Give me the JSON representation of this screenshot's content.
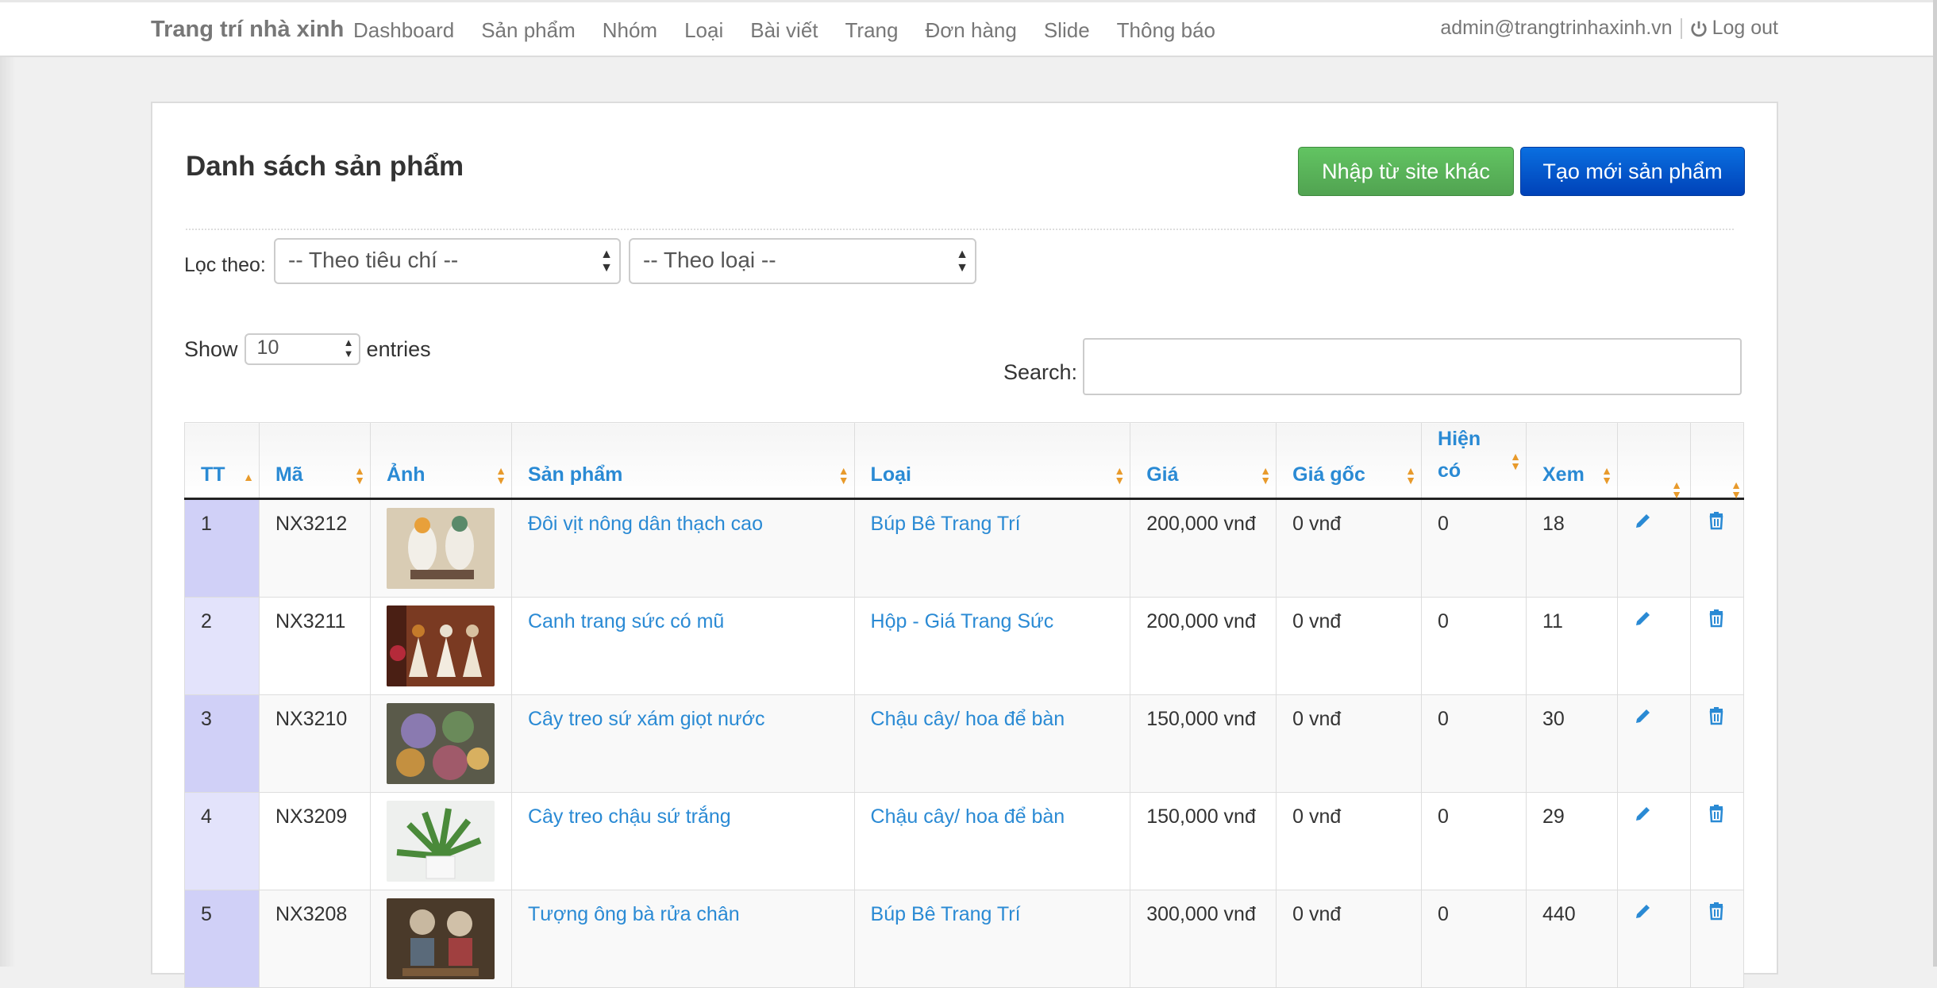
{
  "brand": "Trang trí nhà xinh",
  "nav": [
    "Dashboard",
    "Sản phẩm",
    "Nhóm",
    "Loại",
    "Bài viết",
    "Trang",
    "Đơn hàng",
    "Slide",
    "Thông báo"
  ],
  "user_email": "admin@trangtrinhaxinh.vn",
  "logout": "Log out",
  "page_title": "Danh sách sản phẩm",
  "btn_import": "Nhập từ site khác",
  "btn_create": "Tạo mới sản phẩm",
  "filter_label": "Lọc theo:",
  "filter_criteria": "-- Theo tiêu chí --",
  "filter_type": "-- Theo loại --",
  "show_label": "Show",
  "show_value": "10",
  "entries_label": "entries",
  "search_label": "Search:",
  "headers": [
    "TT",
    "Mã",
    "Ảnh",
    "Sản phẩm",
    "Loại",
    "Giá",
    "Giá gốc",
    "Hiện có",
    "Xem",
    "",
    ""
  ],
  "rows": [
    {
      "tt": "1",
      "ma": "NX3212",
      "name": "Đôi vịt nông dân thạch cao",
      "loai": "Búp Bê Trang Trí",
      "gia": "200,000 vnđ",
      "giagoc": "0 vnđ",
      "hienco": "0",
      "xem": "18",
      "img": "ducks"
    },
    {
      "tt": "2",
      "ma": "NX3211",
      "name": "Canh trang sức có mũ",
      "loai": "Hộp - Giá Trang Sức",
      "gia": "200,000 vnđ",
      "giagoc": "0 vnđ",
      "hienco": "0",
      "xem": "11",
      "img": "jewelry"
    },
    {
      "tt": "3",
      "ma": "NX3210",
      "name": "Cây treo sứ xám giọt nước",
      "loai": "Chậu cây/ hoa để bàn",
      "gia": "150,000 vnđ",
      "giagoc": "0 vnđ",
      "hienco": "0",
      "xem": "30",
      "img": "flowers"
    },
    {
      "tt": "4",
      "ma": "NX3209",
      "name": "Cây treo chậu sứ trắng",
      "loai": "Chậu cây/ hoa để bàn",
      "gia": "150,000 vnđ",
      "giagoc": "0 vnđ",
      "hienco": "0",
      "xem": "29",
      "img": "plant"
    },
    {
      "tt": "5",
      "ma": "NX3208",
      "name": "Tượng ông bà rửa chân",
      "loai": "Búp Bê Trang Trí",
      "gia": "300,000 vnđ",
      "giagoc": "0 vnđ",
      "hienco": "0",
      "xem": "440",
      "img": "elders"
    }
  ],
  "colors": {
    "link": "#2a8ad4",
    "sort_arrow": "#e89a2b",
    "btn_green": "#51a351",
    "btn_blue": "#0044cc"
  },
  "icons": {
    "edit": "pencil-icon",
    "delete": "trash-icon",
    "logout": "power-icon"
  }
}
